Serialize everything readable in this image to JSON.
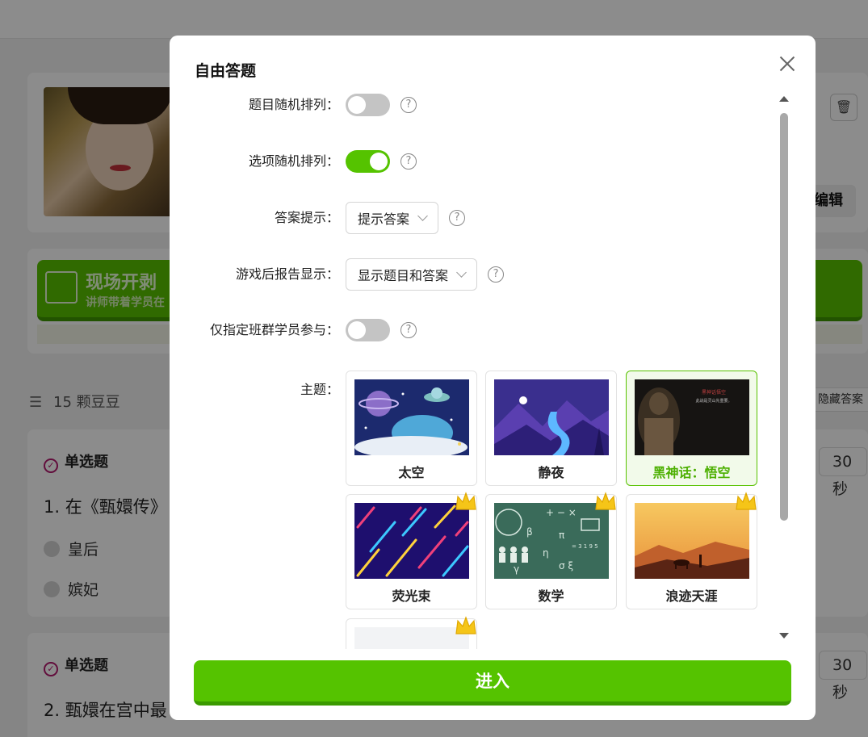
{
  "background": {
    "bean_count": "15 颗豆豆",
    "edit_label": "编辑",
    "hide_answer_label": "隐藏答案",
    "banner": {
      "title": "现场开剥",
      "subtitle": "讲师带着学员在"
    },
    "questions": [
      {
        "type": "单选题",
        "text": "1. 在《甄嬛传》",
        "options": [
          "皇后",
          "嫔妃"
        ],
        "time": "30 秒"
      },
      {
        "type": "单选题",
        "text": "2. 甄嬛在宫中最",
        "options": [],
        "time": "30 秒"
      }
    ]
  },
  "modal": {
    "title": "自由答题",
    "settings": {
      "shuffle_questions": {
        "label": "题目随机排列：",
        "enabled": false
      },
      "shuffle_options": {
        "label": "选项随机排列：",
        "enabled": true
      },
      "answer_hint": {
        "label": "答案提示：",
        "value": "提示答案"
      },
      "report_display": {
        "label": "游戏后报告显示：",
        "value": "显示题目和答案"
      },
      "class_only": {
        "label": "仅指定班群学员参与：",
        "enabled": false
      }
    },
    "theme": {
      "label": "主题：",
      "selected": "黑神话：悟空",
      "items": [
        {
          "name": "太空",
          "premium": false
        },
        {
          "name": "静夜",
          "premium": false
        },
        {
          "name": "黑神话：悟空",
          "premium": false
        },
        {
          "name": "荧光束",
          "premium": true
        },
        {
          "name": "数学",
          "premium": true
        },
        {
          "name": "浪迹天涯",
          "premium": true
        },
        {
          "name": "",
          "premium": true
        }
      ]
    },
    "wukong_text_1": "黑神话悟空",
    "wukong_text_2": "此战是灵山先重要。",
    "math_text": "= 3 1 9 5",
    "enter_label": "进入",
    "help_glyph": "?"
  },
  "colors": {
    "accent_green": "#55c300",
    "selected_text": "#4caf00"
  }
}
